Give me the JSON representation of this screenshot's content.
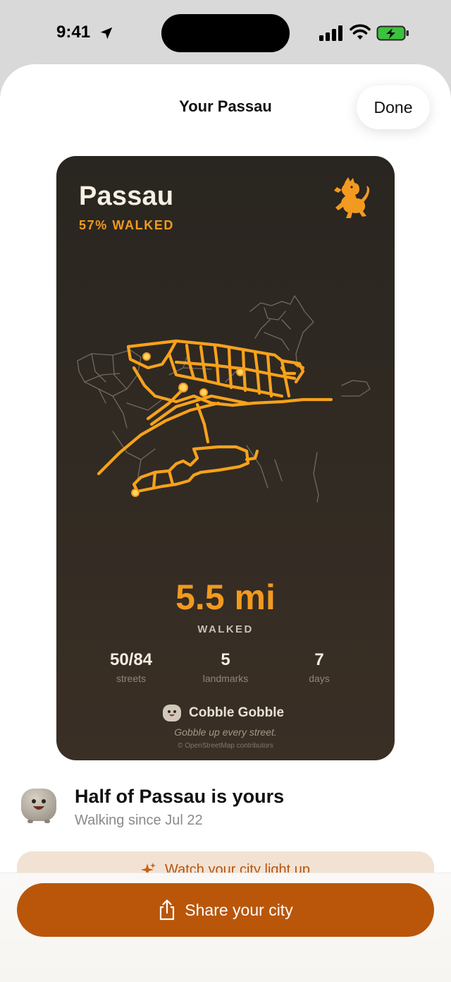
{
  "status_bar": {
    "time": "9:41",
    "icons": [
      "location-arrow-icon",
      "cellular-signal-icon",
      "wifi-icon",
      "battery-charging-icon"
    ]
  },
  "sheet": {
    "title": "Your Passau",
    "done_label": "Done"
  },
  "card": {
    "city": "Passau",
    "progress": "57% WALKED",
    "crest_icon": "lion-crest-icon",
    "distance": "5.5 mi",
    "distance_label": "WALKED",
    "stats": [
      {
        "value": "50/84",
        "label": "streets"
      },
      {
        "value": "5",
        "label": "landmarks"
      },
      {
        "value": "7",
        "label": "days"
      }
    ],
    "brand": "Cobble Gobble",
    "tagline": "Gobble up every street.",
    "attribution": "© OpenStreetMap contributors"
  },
  "summary": {
    "title": "Half of Passau is yours",
    "subtitle": "Walking since Jul 22"
  },
  "actions": {
    "watch_label": "Watch your city light up",
    "share_label": "Share your city"
  },
  "colors": {
    "accent": "#f29a1f",
    "card_bg": "#2e2822",
    "share_button": "#b9560a",
    "watch_button_bg": "#f2e2d4"
  }
}
